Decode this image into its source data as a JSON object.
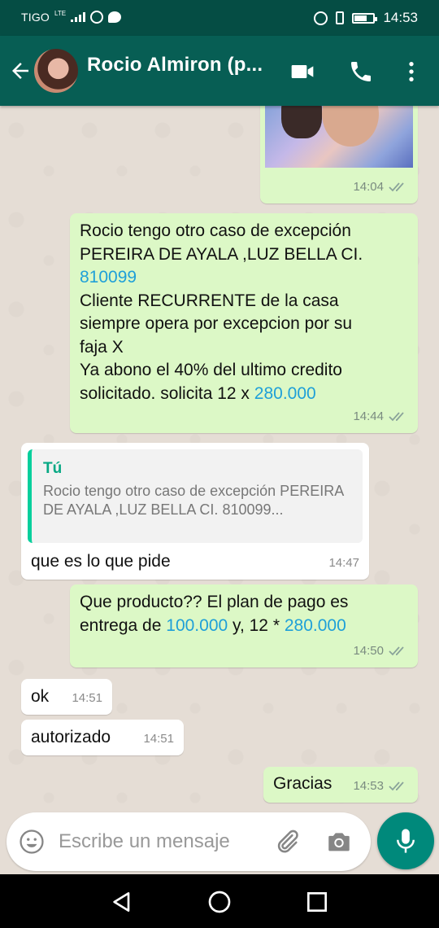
{
  "status_bar": {
    "carrier": "TIGO",
    "network": "LTE",
    "time": "14:53",
    "battery_level": 0.7
  },
  "header": {
    "contact_name": "Rocio Almiron (p..."
  },
  "messages": [
    {
      "direction": "outgoing",
      "type": "image",
      "time": "14:04",
      "status": "read"
    },
    {
      "direction": "outgoing",
      "lines": [
        "Rocio tengo otro caso de excepción",
        "PEREIRA DE AYALA ,LUZ BELLA  CI.",
        "810099",
        "Cliente RECURRENTE de la casa",
        "siempre opera por excepcion por su",
        "faja X",
        "Ya abono el 40% del ultimo credito",
        "solicitado. solicita 12 x ",
        "280.000"
      ],
      "time": "14:44",
      "status": "read"
    },
    {
      "direction": "incoming",
      "quote": {
        "author": "Tú",
        "text": "Rocio tengo otro caso de excepción PEREIRA DE AYALA ,LUZ BELLA  CI. 810099..."
      },
      "text": "que es lo que pide",
      "time": "14:47"
    },
    {
      "direction": "outgoing",
      "parts": [
        "Que producto?? El plan de pago es",
        "entrega de ",
        "100.000",
        " y, 12 * ",
        "280.000"
      ],
      "time": "14:50",
      "status": "read"
    },
    {
      "direction": "incoming",
      "text": "ok",
      "time": "14:51"
    },
    {
      "direction": "incoming",
      "text": "autorizado",
      "time": "14:51"
    },
    {
      "direction": "outgoing",
      "text": "Gracias",
      "time": "14:53",
      "status": "read"
    }
  ],
  "composer": {
    "placeholder": "Escribe un mensaje"
  },
  "colors": {
    "header": "#075e54",
    "status_bar": "#054d44",
    "outgoing_bubble": "#dcf8c6",
    "incoming_bubble": "#ffffff",
    "link": "#1fa0d8",
    "mic_button": "#00897b"
  },
  "icons": {
    "header": [
      "back-arrow-icon",
      "video-call-icon",
      "phone-icon",
      "more-vert-icon"
    ],
    "composer": [
      "emoji-icon",
      "attach-icon",
      "camera-icon",
      "mic-icon"
    ],
    "navbar": [
      "back-triangle-icon",
      "home-circle-icon",
      "recents-square-icon"
    ]
  }
}
